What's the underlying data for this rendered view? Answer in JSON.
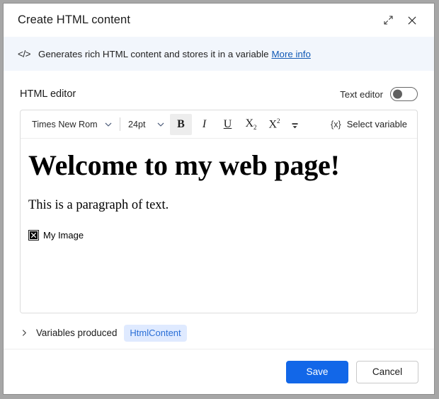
{
  "window": {
    "title": "Create HTML content",
    "expand_icon": "expand-icon",
    "close_icon": "close-icon"
  },
  "banner": {
    "icon": "</>",
    "text": "Generates rich HTML content and stores it in a variable",
    "link_label": "More info"
  },
  "editor_section": {
    "label": "HTML editor",
    "toggle_label": "Text editor",
    "toggle_state": "off"
  },
  "toolbar": {
    "font_family_value": "Times New Rom",
    "font_size_value": "24pt",
    "bold_label": "B",
    "italic_label": "I",
    "underline_label": "U",
    "subscript_label": "X",
    "subscript_sub": "2",
    "superscript_label": "X",
    "superscript_sup": "2",
    "overflow_icon": "overflow-more-icon",
    "select_variable_icon": "{x}",
    "select_variable_label": "Select variable",
    "active_button": "bold"
  },
  "content": {
    "heading": "Welcome to my web page!",
    "paragraph": "This is a paragraph of text.",
    "image_alt": "My Image"
  },
  "variables": {
    "label": "Variables produced",
    "pill": "HtmlContent",
    "expanded": false
  },
  "footer": {
    "save_label": "Save",
    "cancel_label": "Cancel"
  },
  "colors": {
    "primary": "#1267e8",
    "banner_bg": "#f2f6fc",
    "pill_bg": "#dfeaff",
    "pill_text": "#2a6fd6",
    "link": "#1159b5"
  }
}
